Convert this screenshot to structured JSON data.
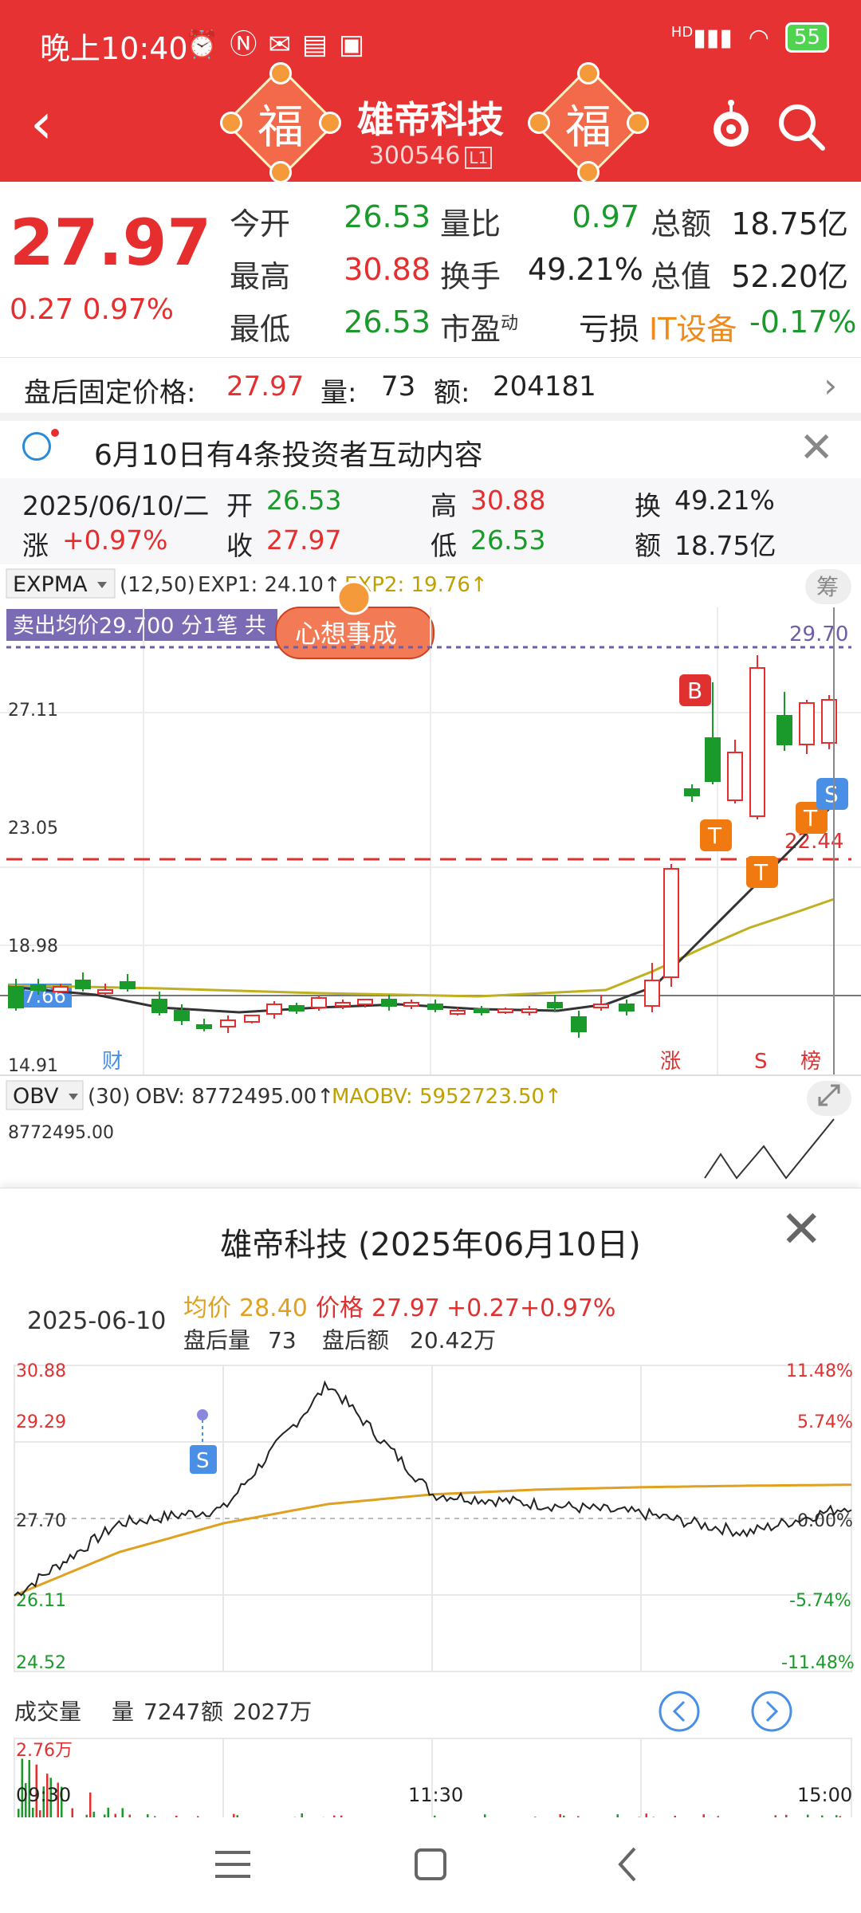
{
  "status_bar": {
    "time": "晚上10:40",
    "icons": [
      "alarm-icon",
      "nfc-icon",
      "wechat-icon",
      "app-icon",
      "app-icon"
    ],
    "signal": "HD",
    "battery": "55"
  },
  "header": {
    "name": "雄帝科技",
    "code": "300546",
    "level": "L1",
    "decor_char": "福"
  },
  "quote": {
    "price": "27.97",
    "change": "0.27",
    "change_pct": "0.97%",
    "labels": {
      "open": "今开",
      "high": "最高",
      "low": "最低",
      "vol_ratio": "量比",
      "turnover": "换手",
      "pe": "市盈",
      "pe_sup": "动",
      "amount": "总额",
      "mkt_cap": "总值",
      "loss": "亏损"
    },
    "open": "26.53",
    "high": "30.88",
    "low": "26.53",
    "vol_ratio": "0.97",
    "turnover": "49.21%",
    "amount": "18.75亿",
    "mkt_cap": "52.20亿",
    "sector": "IT设备",
    "sector_pct": "-0.17%"
  },
  "after_hours": {
    "label": "盘后固定价格:",
    "price": "27.97",
    "vol_label": "量:",
    "vol": "73",
    "amt_label": "额:",
    "amt": "204181"
  },
  "notice": {
    "text": "6月10日有4条投资者互动内容"
  },
  "day_bar": {
    "date": "2025/06/10/二",
    "open_label": "开",
    "open": "26.53",
    "high_label": "高",
    "high": "30.88",
    "turnover_label": "换",
    "turnover": "49.21%",
    "change_label": "涨",
    "change": "+0.97%",
    "close_label": "收",
    "close": "27.97",
    "low_label": "低",
    "low": "26.53",
    "amount_label": "额",
    "amount": "18.75亿"
  },
  "kline": {
    "indicator": "EXPMA",
    "params": "(12,50)",
    "exp1": "EXP1: 24.10↑",
    "exp2": "EXP2: 19.76↑",
    "badge": "筹",
    "sell_avg": "卖出均价29.700 分1笔 共",
    "banner": "心想事成",
    "y_labels": [
      "27.11",
      "23.05",
      "18.98",
      "14.91"
    ],
    "current_tag": "17.66",
    "level_high": "29.70",
    "level_low": "22.44",
    "markers": [
      "B",
      "T",
      "T",
      "T",
      "S"
    ],
    "bottom_tags": [
      "财",
      "涨",
      "S",
      "榜"
    ],
    "obv_indicator": "OBV",
    "obv_params": "(30)",
    "obv": "OBV: 8772495.00↑",
    "maobv": "MAOBV: 5952723.50↑",
    "obv_axis": "8772495.00",
    "chart_data": {
      "type": "candlestick",
      "ylim": [
        14.91,
        29.7
      ],
      "candles_hint": "daily candles, last ~10 sessions rally from ~17.6 to ~28",
      "last": {
        "open": 26.53,
        "high": 30.88,
        "low": 26.53,
        "close": 27.97
      }
    }
  },
  "intraday": {
    "title": "雄帝科技 (2025年06月10日)",
    "date": "2025-06-10",
    "avg_label": "均价",
    "avg": "28.40",
    "price_label": "价格",
    "price": "27.97",
    "chg": "+0.27",
    "chg_pct": "+0.97%",
    "ah_vol_label": "盘后量",
    "ah_vol": "73",
    "ah_amt_label": "盘后额",
    "ah_amt": "20.42万",
    "y_left": [
      "30.88",
      "29.29",
      "27.70",
      "26.11",
      "24.52"
    ],
    "y_right": [
      "11.48%",
      "5.74%",
      "0.00%",
      "-5.74%",
      "-11.48%"
    ],
    "s_marker": "S",
    "vol_title": "成交量",
    "vol_label": "量",
    "vol": "7247",
    "amt_label": "额",
    "amt": "2027万",
    "vol_max": "2.76万",
    "time_labels": [
      "09:30",
      "11:30",
      "15:00"
    ],
    "chart_data": {
      "type": "line",
      "title": "雄帝科技 (2025年06月10日)",
      "ylim": [
        24.52,
        30.88
      ],
      "x": [
        "09:30",
        "11:30",
        "15:00"
      ],
      "series": [
        {
          "name": "价格",
          "values": [
            26.1,
            27.6,
            27.9,
            30.5,
            28.2,
            28.0,
            27.8,
            27.4,
            27.97
          ]
        },
        {
          "name": "均价",
          "values": [
            26.1,
            27.0,
            27.6,
            28.0,
            28.2,
            28.3,
            28.35,
            28.38,
            28.4
          ]
        }
      ]
    }
  },
  "colors": {
    "brand_red": "#e63232",
    "up": "#e62e2e",
    "down": "#1a9a2a",
    "avg_line": "#e0a020"
  }
}
